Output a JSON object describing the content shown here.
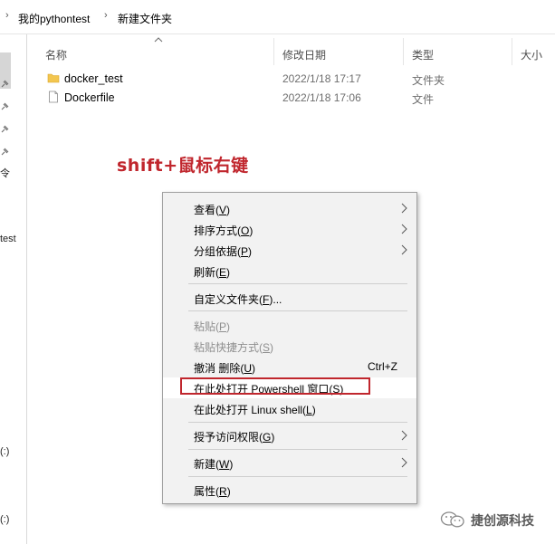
{
  "address_bar": {
    "crumbs": [
      "我的pythontest",
      "新建文件夹"
    ]
  },
  "nav_pane": {
    "clipped_labels": [
      "令",
      "test",
      "(:)",
      "(:)"
    ]
  },
  "columns": [
    "名称",
    "修改日期",
    "类型",
    "大小"
  ],
  "files": [
    {
      "name": "docker_test",
      "date": "2022/1/18 17:17",
      "type": "文件夹",
      "icon": "folder-icon"
    },
    {
      "name": "Dockerfile",
      "date": "2022/1/18 17:06",
      "type": "文件",
      "icon": "file-icon"
    }
  ],
  "annotation": "shift+鼠标右键",
  "context_menu": {
    "items": [
      {
        "label": "查看",
        "key": "V",
        "submenu": true,
        "disabled": false
      },
      {
        "label": "排序方式",
        "key": "O",
        "submenu": true,
        "disabled": false
      },
      {
        "label": "分组依据",
        "key": "P",
        "submenu": true,
        "disabled": false
      },
      {
        "label": "刷新",
        "key": "E",
        "submenu": false,
        "disabled": false
      },
      {
        "label": "自定义文件夹",
        "key": "F",
        "suffix": "...",
        "submenu": false,
        "disabled": false
      },
      {
        "label": "粘贴",
        "key": "P",
        "submenu": false,
        "disabled": true
      },
      {
        "label": "粘贴快捷方式",
        "key": "S",
        "submenu": false,
        "disabled": true
      },
      {
        "label": "撤消 删除",
        "key": "U",
        "shortcut": "Ctrl+Z",
        "submenu": false,
        "disabled": false
      },
      {
        "label": "在此处打开 Powershell 窗口",
        "key": "S",
        "submenu": false,
        "disabled": false,
        "highlighted": true
      },
      {
        "label": "在此处打开 Linux shell",
        "key": "L",
        "submenu": false,
        "disabled": false
      },
      {
        "label": "授予访问权限",
        "key": "G",
        "submenu": true,
        "disabled": false
      },
      {
        "label": "新建",
        "key": "W",
        "submenu": true,
        "disabled": false
      },
      {
        "label": "属性",
        "key": "R",
        "submenu": false,
        "disabled": false
      }
    ]
  },
  "watermark": "捷创源科技",
  "colors": {
    "annotation_red": "#c0262d",
    "menu_bg": "#f2f2f2",
    "folder_yellow": "#f3c64f"
  }
}
